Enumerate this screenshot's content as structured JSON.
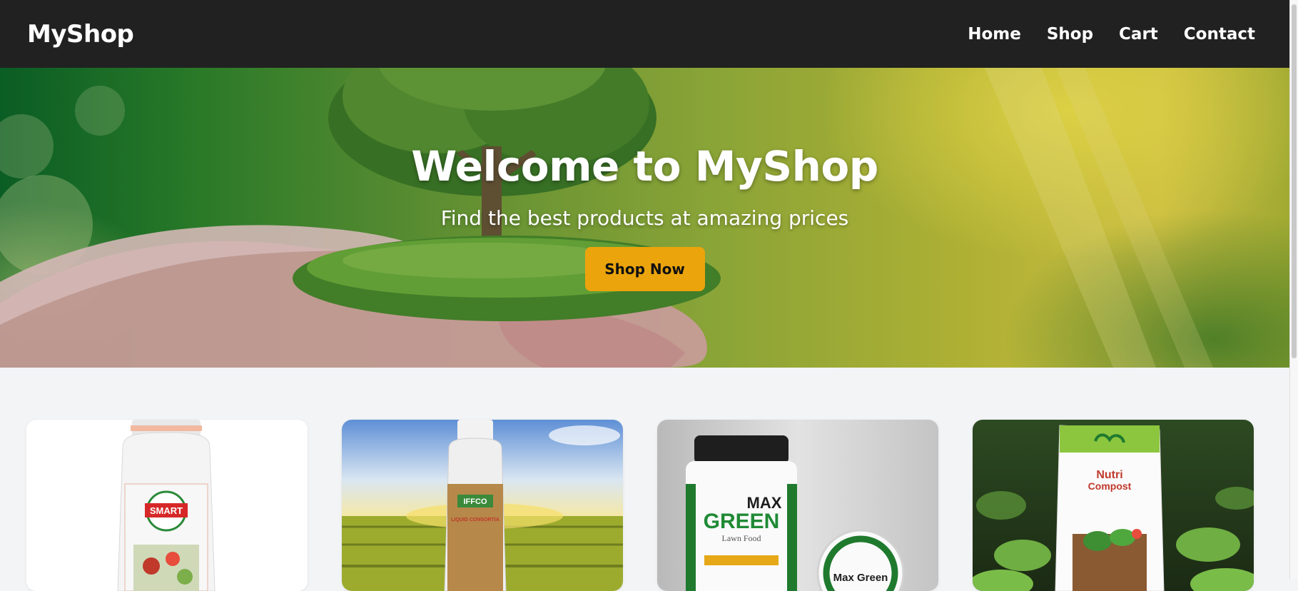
{
  "nav": {
    "brand": "MyShop",
    "links": [
      "Home",
      "Shop",
      "Cart",
      "Contact"
    ]
  },
  "hero": {
    "title": "Welcome to MyShop",
    "subtitle": "Find the best products at amazing prices",
    "button_label": "Shop Now"
  },
  "products": [
    {
      "image_labels": [
        "SMART"
      ]
    },
    {
      "image_labels": [
        "IFFCO",
        "LIQUID CONSORTIA"
      ]
    },
    {
      "image_labels": [
        "MAX",
        "GREEN",
        "Lawn Food",
        "Max Green"
      ]
    },
    {
      "image_labels": [
        "Nutri",
        "Compost"
      ]
    }
  ],
  "colors": {
    "navbar_bg": "#212121",
    "accent": "#eba40c",
    "page_bg": "#f3f4f6"
  }
}
